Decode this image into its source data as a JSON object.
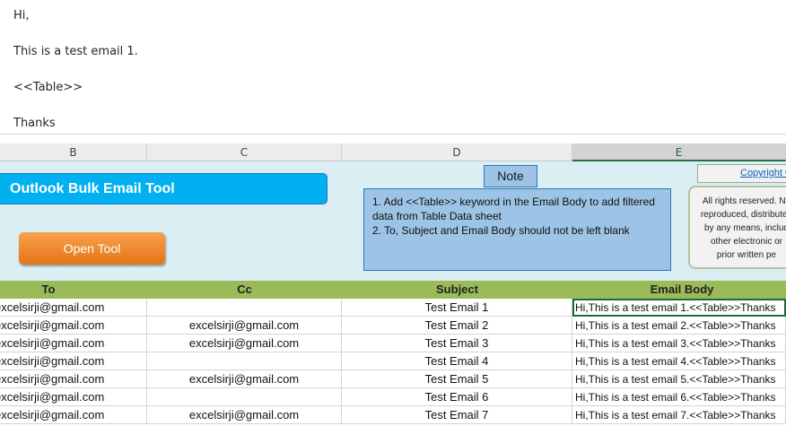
{
  "preview": {
    "lines": [
      "Hi,",
      "This is a test email 1.",
      "<<Table>>",
      "Thanks"
    ]
  },
  "columns": [
    "B",
    "C",
    "D",
    "E"
  ],
  "banner": {
    "title": "Outlook Bulk Email Tool",
    "open_button": "Open Tool",
    "note_label": "Note",
    "note_lines": [
      "1. Add <<Table>> keyword in the Email Body to add filtered",
      "data from Table Data sheet",
      "2. To, Subject and Email Body should not be left blank"
    ],
    "copyright_link": "Copyright ©",
    "rights_lines": [
      "All rights reserved. No",
      "reproduced, distributed",
      "by any means, includ",
      "other electronic or",
      "prior written pe"
    ]
  },
  "table": {
    "headers": [
      "To",
      "Cc",
      "Subject",
      "Email Body"
    ],
    "rows": [
      {
        "to": "excelsirji@gmail.com",
        "cc": "",
        "subject": "Test Email 1",
        "body": "Hi,This is a test email 1.<<Table>>Thanks"
      },
      {
        "to": "excelsirji@gmail.com",
        "cc": "excelsirji@gmail.com",
        "subject": "Test Email 2",
        "body": "Hi,This is a test email 2.<<Table>>Thanks"
      },
      {
        "to": "excelsirji@gmail.com",
        "cc": "excelsirji@gmail.com",
        "subject": "Test Email 3",
        "body": "Hi,This is a test email 3.<<Table>>Thanks"
      },
      {
        "to": "excelsirji@gmail.com",
        "cc": "",
        "subject": "Test Email 4",
        "body": "Hi,This is a test email 4.<<Table>>Thanks"
      },
      {
        "to": "excelsirji@gmail.com",
        "cc": "excelsirji@gmail.com",
        "subject": "Test Email 5",
        "body": "Hi,This is a test email 5.<<Table>>Thanks"
      },
      {
        "to": "excelsirji@gmail.com",
        "cc": "",
        "subject": "Test Email 6",
        "body": "Hi,This is a test email 6.<<Table>>Thanks"
      },
      {
        "to": "excelsirji@gmail.com",
        "cc": "excelsirji@gmail.com",
        "subject": "Test Email 7",
        "body": "Hi,This is a test email 7.<<Table>>Thanks"
      }
    ]
  }
}
